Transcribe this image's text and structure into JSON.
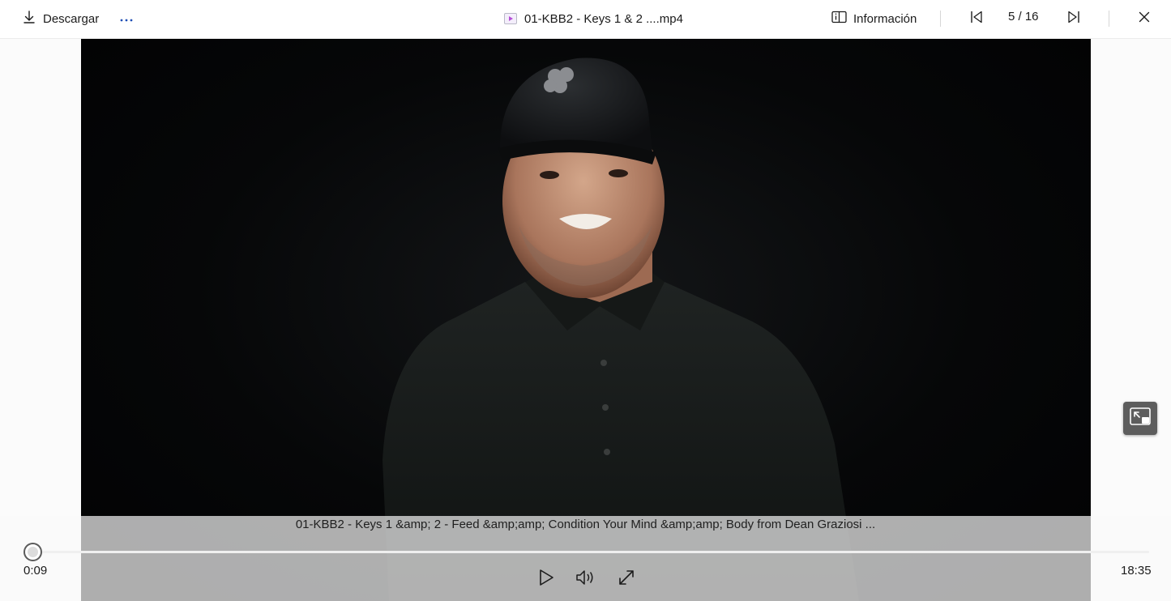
{
  "toolbar": {
    "download_label": "Descargar",
    "more_label": "···",
    "file_title": "01-KBB2 - Keys 1 & 2 ....mp4",
    "info_label": "Información",
    "counter": "5 / 16"
  },
  "player": {
    "caption": "01-KBB2 - Keys 1 &amp; 2 - Feed &amp;amp; Condition Your Mind &amp;amp; Body from Dean Graziosi ...",
    "current_time": "0:09",
    "total_time": "18:35",
    "progress_fraction": 0.008
  },
  "colors": {
    "accent_video_icon": "#b44fd6",
    "video_bg": "#060708",
    "control_band": "#dadada"
  },
  "icons": {
    "download": "download-icon",
    "more": "more-dots-icon",
    "file": "video-file-icon",
    "info": "info-panel-icon",
    "prev": "previous-icon",
    "next": "next-icon",
    "close": "close-icon",
    "play": "play-icon",
    "volume": "volume-icon",
    "fullscreen": "fullscreen-icon",
    "pip": "picture-in-picture-icon"
  }
}
